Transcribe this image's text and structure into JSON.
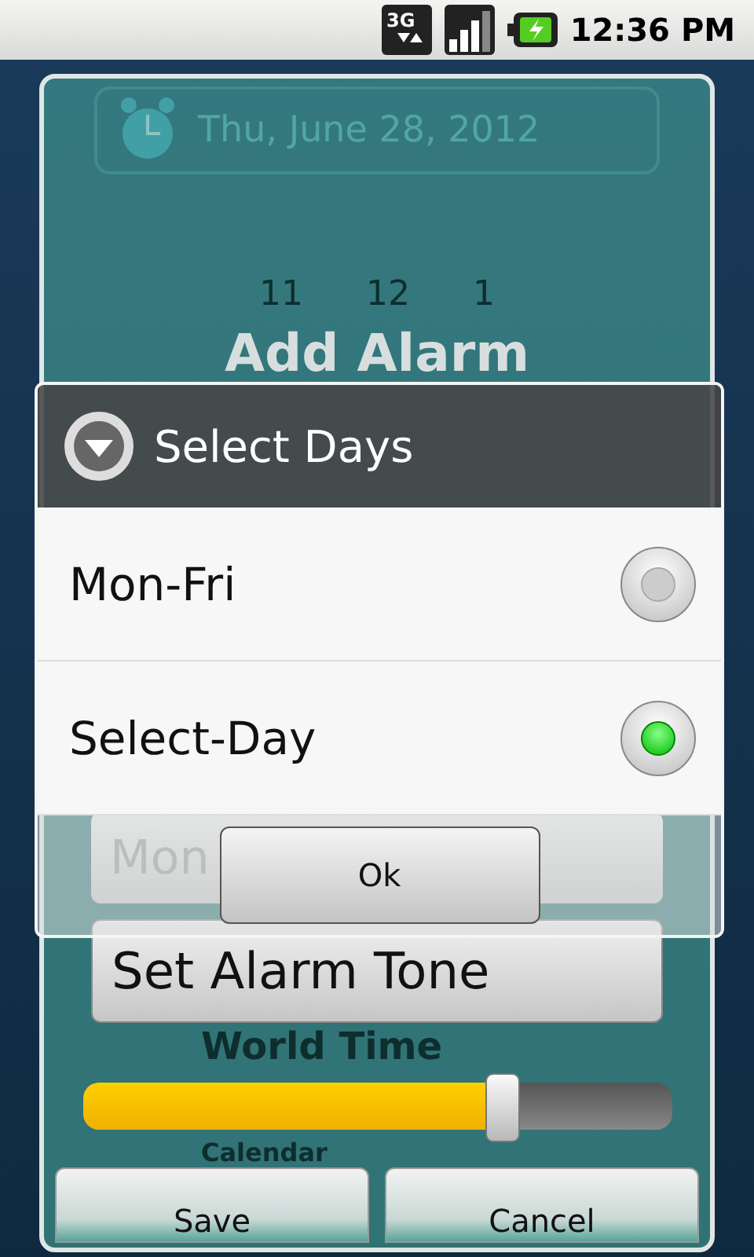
{
  "status_bar": {
    "network": "3G",
    "time": "12:36 PM"
  },
  "background_app": {
    "date": "Thu, June 28, 2012",
    "clock_numbers": [
      "11",
      "12",
      "1"
    ],
    "world_time": "World Time",
    "calendar": "Calendar"
  },
  "add_alarm_dialog": {
    "title": "Add Alarm",
    "days_field": "Mon",
    "tone_button": "Set Alarm Tone",
    "volume": {
      "level": 0.71
    },
    "buttons": [
      "Save",
      "Cancel"
    ]
  },
  "select_days_dialog": {
    "title": "Select Days",
    "options": [
      {
        "label": "Mon-Fri",
        "selected": false
      },
      {
        "label": "Select-Day",
        "selected": true
      }
    ],
    "ok": "Ok"
  }
}
